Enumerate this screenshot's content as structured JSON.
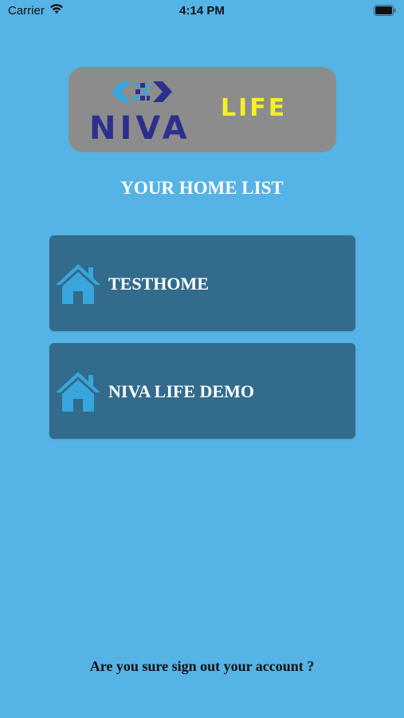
{
  "status_bar": {
    "carrier": "Carrier",
    "time": "4:14 PM",
    "wifi_icon": "wifi-icon",
    "battery_icon": "battery-icon"
  },
  "logo": {
    "brand": "NIVA",
    "suffix": "LIFE",
    "brand_color": "#2d2f8e",
    "suffix_color": "#f4f026"
  },
  "home_list": {
    "title": "YOUR HOME LIST",
    "homes": [
      {
        "name": "TESTHOME",
        "icon": "house-icon"
      },
      {
        "name": "NIVA LIFE DEMO",
        "icon": "house-icon"
      }
    ]
  },
  "signout": {
    "label": "Are you sure sign out your account ?"
  },
  "colors": {
    "background": "#55b3e5",
    "card": "#326b8b",
    "icon": "#38a6dc"
  }
}
